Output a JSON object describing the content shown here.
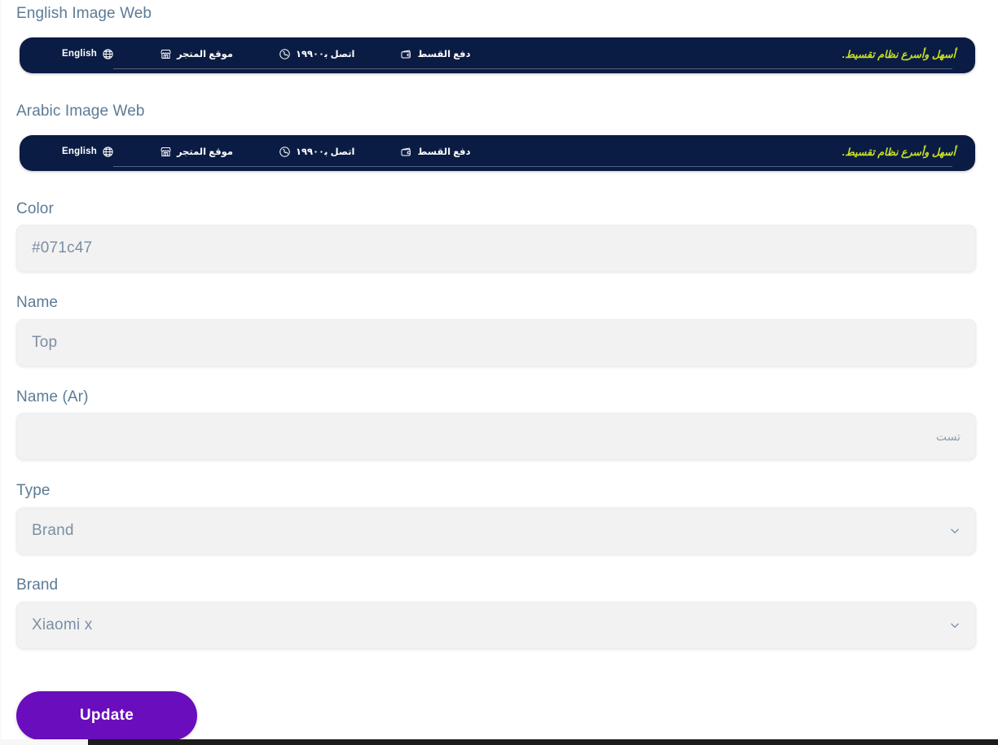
{
  "page": {
    "background": "#ffffff",
    "label_color": "#5c7b96"
  },
  "previews": [
    {
      "label": "English Image Web",
      "banner": {
        "background": "#0b1c44",
        "items": [
          {
            "text": "English",
            "icon": "globe-icon",
            "ltr": true
          },
          {
            "text": "موقع المتجر",
            "icon": "store-icon",
            "ltr": false
          },
          {
            "text": "اتصل ب‍١٩٩٠٠",
            "icon": "phone-icon",
            "ltr": false
          },
          {
            "text": "دفع القسط",
            "icon": "wallet-icon",
            "ltr": false
          }
        ],
        "tagline": "أسهل وأسرع نظام تقسيط.",
        "tagline_color": "#c8e022"
      }
    },
    {
      "label": "Arabic Image Web",
      "banner": {
        "background": "#0b1c44",
        "items": [
          {
            "text": "English",
            "icon": "globe-icon",
            "ltr": true
          },
          {
            "text": "موقع المتجر",
            "icon": "store-icon",
            "ltr": false
          },
          {
            "text": "اتصل ب‍١٩٩٠٠",
            "icon": "phone-icon",
            "ltr": false
          },
          {
            "text": "دفع القسط",
            "icon": "wallet-icon",
            "ltr": false
          }
        ],
        "tagline": "أسهل وأسرع نظام تقسيط.",
        "tagline_color": "#c8e022"
      }
    }
  ],
  "form": {
    "color": {
      "label": "Color",
      "value": "#071c47",
      "placeholder": "#071c47"
    },
    "name": {
      "label": "Name",
      "value": "Top",
      "placeholder": "Top"
    },
    "name_ar": {
      "label": "Name (Ar)",
      "value": "تست",
      "placeholder": "تست"
    },
    "type": {
      "label": "Type",
      "value": "Brand",
      "options": [
        "Brand"
      ]
    },
    "brand": {
      "label": "Brand",
      "value": "Xiaomi x",
      "options": [
        "Xiaomi x"
      ]
    },
    "submit": {
      "label": "Update",
      "color": "#6a0dbd"
    }
  }
}
